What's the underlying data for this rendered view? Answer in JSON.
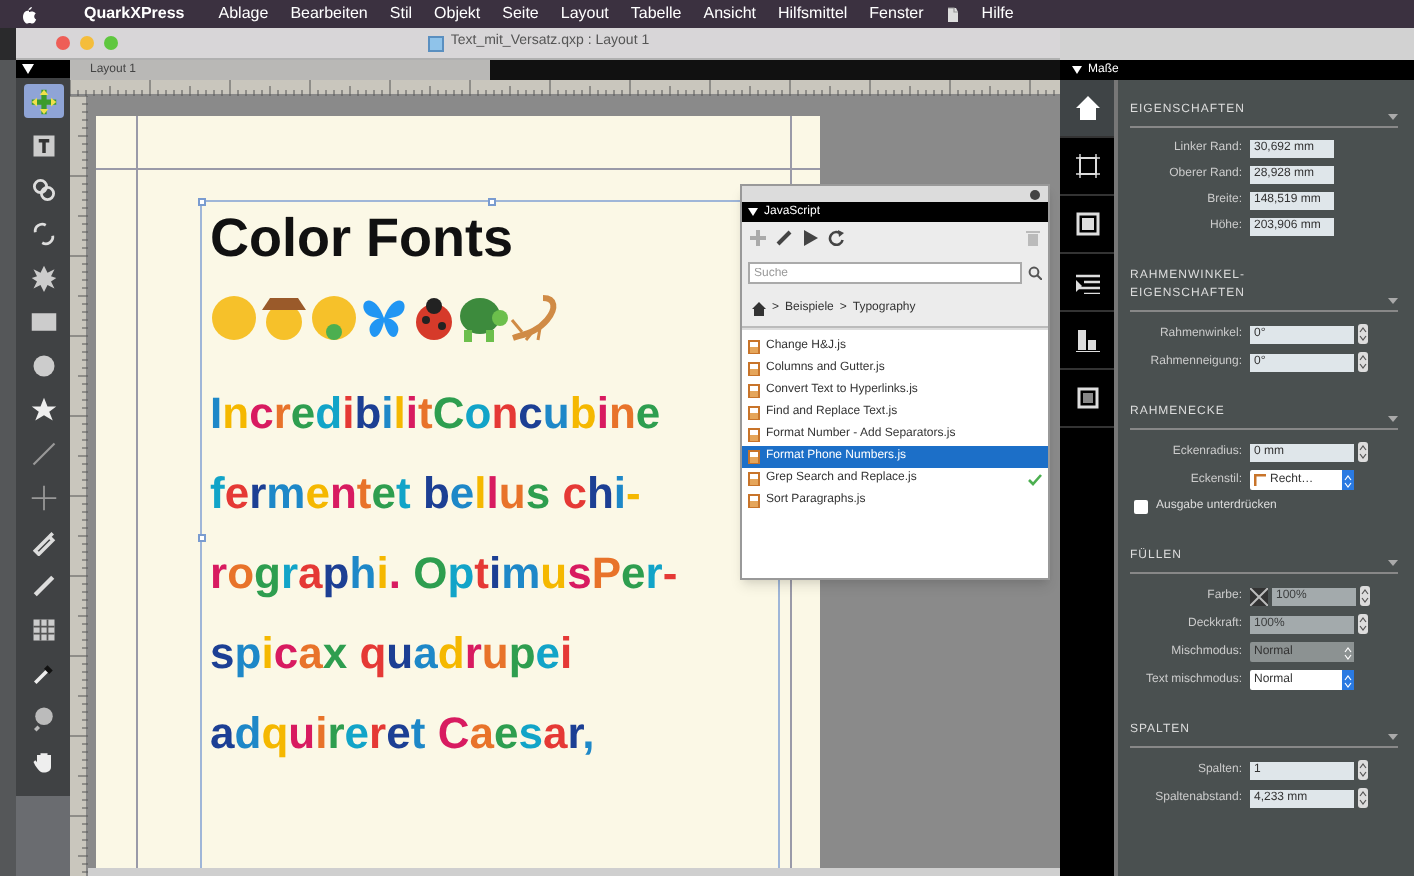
{
  "menu_bar": {
    "items": [
      {
        "label": "QuarkXPress",
        "kind": "app"
      },
      {
        "label": "Ablage",
        "kind": "menu"
      },
      {
        "label": "Bearbeiten",
        "kind": "menu"
      },
      {
        "label": "Stil",
        "kind": "menu"
      },
      {
        "label": "Objekt",
        "kind": "menu"
      },
      {
        "label": "Seite",
        "kind": "menu"
      },
      {
        "label": "Layout",
        "kind": "menu"
      },
      {
        "label": "Tabelle",
        "kind": "menu"
      },
      {
        "label": "Ansicht",
        "kind": "menu"
      },
      {
        "label": "Hilfsmittel",
        "kind": "menu"
      },
      {
        "label": "Fenster",
        "kind": "menu"
      },
      {
        "label": "Hilfe",
        "kind": "menu"
      }
    ]
  },
  "document_window": {
    "title": "Text_mit_Versatz.qxp : Layout 1",
    "tabs": [
      {
        "label": "Layout 1",
        "selected": true
      }
    ],
    "page": {
      "heading": "Color Fonts",
      "lines": [
        "IncredibilitConcubine",
        "fermentet bellus chi-",
        "rographi. OptimusPer-",
        "spicax quadrupei",
        "adquireret Caesar,"
      ]
    }
  },
  "tools": [
    {
      "kind": "item",
      "selected": true
    },
    {
      "kind": "text",
      "selected": false
    },
    {
      "kind": "link",
      "selected": false
    },
    {
      "kind": "unlink",
      "selected": false
    },
    {
      "kind": "starburst",
      "selected": false
    },
    {
      "kind": "rect",
      "selected": false
    },
    {
      "kind": "oval",
      "selected": false
    },
    {
      "kind": "star",
      "selected": false
    },
    {
      "kind": "line",
      "selected": false
    },
    {
      "kind": "crossline",
      "selected": false
    },
    {
      "kind": "pen",
      "selected": false
    },
    {
      "kind": "pencil",
      "selected": false
    },
    {
      "kind": "table",
      "selected": false
    },
    {
      "kind": "eyedropper",
      "selected": false
    },
    {
      "kind": "zoom",
      "selected": false
    },
    {
      "kind": "hand",
      "selected": false
    }
  ],
  "javascript_palette": {
    "title": "JavaScript",
    "search": {
      "placeholder": "Suche"
    },
    "breadcrumb": [
      {
        "separator": ">",
        "label": "Beispiele"
      },
      {
        "separator": ">",
        "label": "Typography"
      }
    ],
    "scripts": [
      {
        "name": "Change H&J.js",
        "selected": false,
        "checked": false
      },
      {
        "name": "Columns and Gutter.js",
        "selected": false,
        "checked": false
      },
      {
        "name": "Convert Text to Hyperlinks.js",
        "selected": false,
        "checked": false
      },
      {
        "name": "Find and Replace Text.js",
        "selected": false,
        "checked": false
      },
      {
        "name": "Format Number - Add Separators.js",
        "selected": false,
        "checked": false
      },
      {
        "name": "Format Phone Numbers.js",
        "selected": true,
        "checked": false
      },
      {
        "name": "Grep Search and Replace.js",
        "selected": false,
        "checked": true
      },
      {
        "name": "Sort Paragraphs.js",
        "selected": false,
        "checked": false
      }
    ]
  },
  "measurements_panel": {
    "title": "Maße",
    "tabs": [
      {
        "kind": "home",
        "selected": true
      },
      {
        "kind": "frame",
        "selected": false
      },
      {
        "kind": "box",
        "selected": false
      },
      {
        "kind": "paragraph",
        "selected": false
      },
      {
        "kind": "align",
        "selected": false
      },
      {
        "kind": "square",
        "selected": false
      }
    ],
    "sections": [
      {
        "title": "EIGENSCHAFTEN",
        "fields": [
          {
            "kind": "text",
            "label": "Linker Rand:",
            "value": "30,692 mm"
          },
          {
            "kind": "text",
            "label": "Oberer Rand:",
            "value": "28,928 mm"
          },
          {
            "kind": "text",
            "label": "Breite:",
            "value": "148,519 mm"
          },
          {
            "kind": "text",
            "label": "Höhe:",
            "value": "203,906 mm"
          }
        ]
      },
      {
        "title": "RAHMENWINKEL-EIGENSCHAFTEN",
        "fields": [
          {
            "kind": "stepper",
            "label": "Rahmenwinkel:",
            "value": "0°"
          },
          {
            "kind": "stepper",
            "label": "Rahmenneigung:",
            "value": "0°"
          }
        ]
      },
      {
        "title": "RAHMENECKE",
        "fields": [
          {
            "kind": "stepper",
            "label": "Eckenradius:",
            "value": "0 mm"
          },
          {
            "kind": "dropdown",
            "label": "Eckenstil:",
            "value": "Recht…",
            "disabled": false
          },
          {
            "kind": "checkbox",
            "label": "Ausgabe unterdrücken",
            "checked": false
          }
        ]
      },
      {
        "title": "FÜLLEN",
        "fields": [
          {
            "kind": "color",
            "label": "Farbe:",
            "value": "100%",
            "disabled": true
          },
          {
            "kind": "stepper",
            "label": "Deckkraft:",
            "value": "100%",
            "disabled": true
          },
          {
            "kind": "dropdown",
            "label": "Mischmodus:",
            "value": "Normal",
            "disabled": true
          },
          {
            "kind": "dropdown",
            "label": "Text mischmodus:",
            "value": "Normal",
            "disabled": false
          }
        ]
      },
      {
        "title": "SPALTEN",
        "fields": [
          {
            "kind": "stepper",
            "label": "Spalten:",
            "value": "1"
          },
          {
            "kind": "stepper",
            "label": "Spaltenabstand:",
            "value": "4,233 mm"
          }
        ]
      }
    ]
  }
}
